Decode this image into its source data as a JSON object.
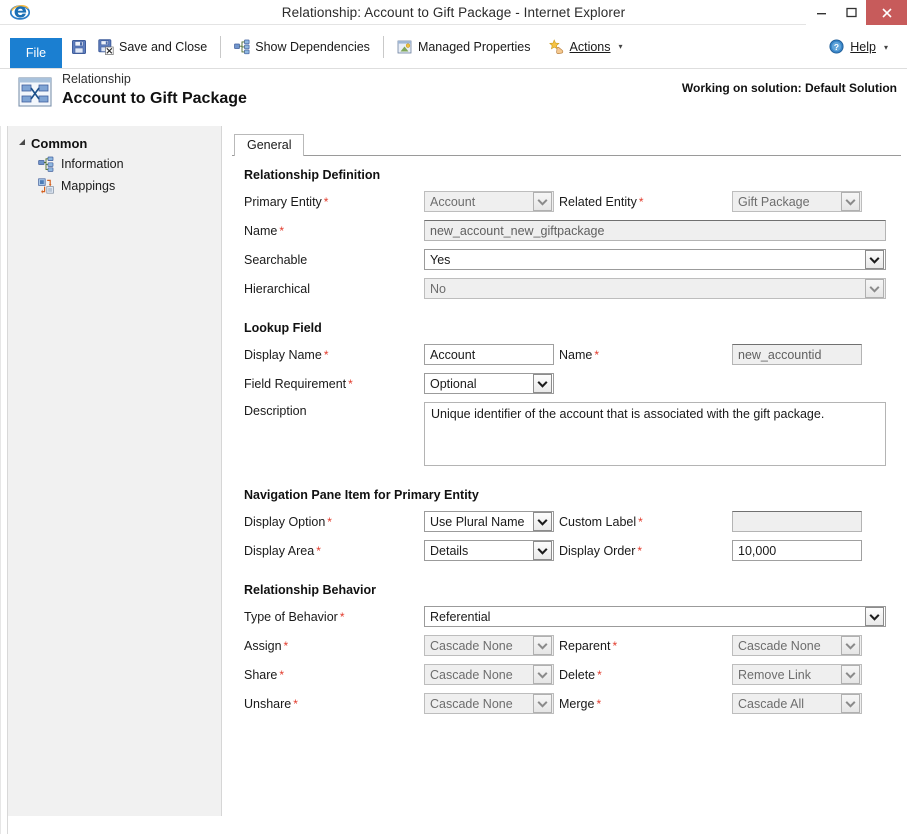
{
  "window": {
    "title": "Relationship: Account to Gift Package - Internet Explorer",
    "minimize_label": "–",
    "maximize_label": "☐",
    "close_label": "✕",
    "browser_icon": "internet-explorer-icon"
  },
  "ribbon": {
    "file_label": "File",
    "save_icon_label": "",
    "save_and_close_label": "Save and Close",
    "show_dependencies_label": "Show Dependencies",
    "managed_properties_label": "Managed Properties",
    "actions_label": "Actions",
    "actions_caret": "▾",
    "help_label": "Help",
    "help_caret": "▾"
  },
  "header": {
    "subtitle": "Relationship",
    "title": "Account to Gift Package",
    "solution_note": "Working on solution: Default Solution"
  },
  "sidebar": {
    "group_label": "Common",
    "group_caret": "◢",
    "items": [
      {
        "label": "Information",
        "icon": "relationship-icon"
      },
      {
        "label": "Mappings",
        "icon": "mappings-icon"
      }
    ]
  },
  "tabs": [
    {
      "label": "General",
      "active": true
    }
  ],
  "sections": {
    "relationship_definition": {
      "title": "Relationship Definition",
      "primary_entity": {
        "label": "Primary Entity",
        "required": "*",
        "value": "Account",
        "disabled": true
      },
      "related_entity": {
        "label": "Related Entity",
        "required": "*",
        "value": "Gift Package",
        "disabled": true
      },
      "name": {
        "label": "Name",
        "required": "*",
        "value": "new_account_new_giftpackage",
        "disabled": true
      },
      "searchable": {
        "label": "Searchable",
        "required": "",
        "value": "Yes",
        "disabled": false
      },
      "hierarchical": {
        "label": "Hierarchical",
        "required": "",
        "value": "No",
        "disabled": true
      }
    },
    "lookup_field": {
      "title": "Lookup Field",
      "display_name": {
        "label": "Display Name",
        "required": "*",
        "value": "Account",
        "disabled": false
      },
      "name": {
        "label": "Name",
        "required": "*",
        "value": "new_accountid",
        "disabled": true
      },
      "field_requirement": {
        "label": "Field Requirement",
        "required": "*",
        "value": "Optional",
        "disabled": false
      },
      "description": {
        "label": "Description",
        "required": "",
        "value": "Unique identifier of the account that is associated with the gift package."
      }
    },
    "navigation_pane": {
      "title": "Navigation Pane Item for Primary Entity",
      "display_option": {
        "label": "Display Option",
        "required": "*",
        "value": "Use Plural Name",
        "disabled": false
      },
      "custom_label": {
        "label": "Custom Label",
        "required": "*",
        "value": "",
        "disabled": true
      },
      "display_area": {
        "label": "Display Area",
        "required": "*",
        "value": "Details",
        "disabled": false
      },
      "display_order": {
        "label": "Display Order",
        "required": "*",
        "value": "10,000",
        "disabled": false
      }
    },
    "relationship_behavior": {
      "title": "Relationship Behavior",
      "type_of_behavior": {
        "label": "Type of Behavior",
        "required": "*",
        "value": "Referential",
        "disabled": false
      },
      "assign": {
        "label": "Assign",
        "required": "*",
        "value": "Cascade None",
        "disabled": true
      },
      "reparent": {
        "label": "Reparent",
        "required": "*",
        "value": "Cascade None",
        "disabled": true
      },
      "share": {
        "label": "Share",
        "required": "*",
        "value": "Cascade None",
        "disabled": true
      },
      "delete": {
        "label": "Delete",
        "required": "*",
        "value": "Remove Link",
        "disabled": true
      },
      "unshare": {
        "label": "Unshare",
        "required": "*",
        "value": "Cascade None",
        "disabled": true
      },
      "merge": {
        "label": "Merge",
        "required": "*",
        "value": "Cascade All",
        "disabled": true
      }
    }
  },
  "colors": {
    "file_tab_blue": "#1b7fd1",
    "close_button_red": "#c75b5b",
    "required_asterisk_red": "#e23b2c",
    "sidebar_bg": "#f1f1f1"
  }
}
